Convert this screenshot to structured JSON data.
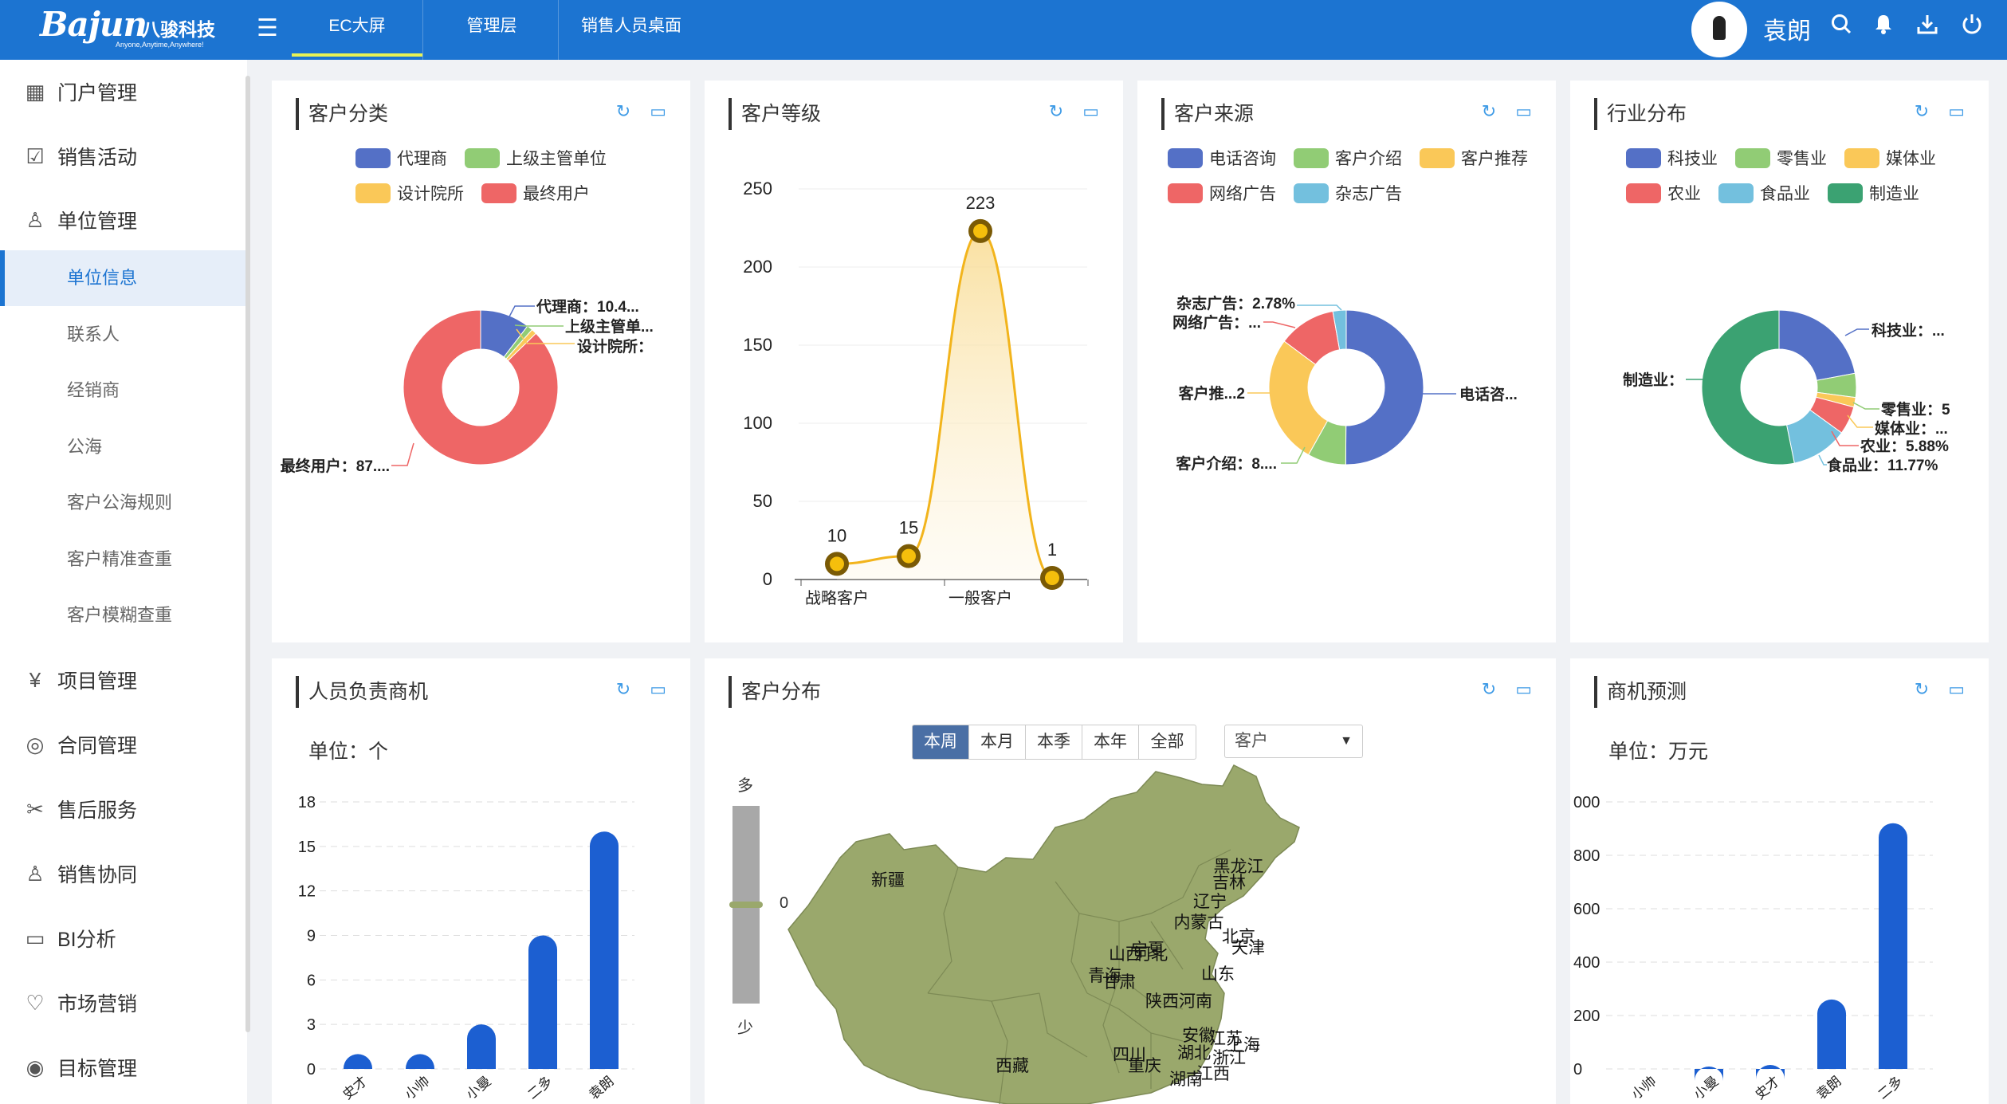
{
  "brand": {
    "name": "Bajun",
    "name_cn": "八骏科技",
    "tagline": "Anyone,Anytime,Anywhere!"
  },
  "nav": {
    "tabs": [
      "EC大屏",
      "管理层",
      "销售人员桌面"
    ]
  },
  "user": {
    "name": "袁朗"
  },
  "sidebar": {
    "items": [
      "门户管理",
      "销售活动",
      "单位管理"
    ],
    "sub_items": [
      "单位信息",
      "联系人",
      "经销商",
      "公海",
      "客户公海规则",
      "客户精准查重",
      "客户模糊查重"
    ],
    "items2": [
      "项目管理",
      "合同管理",
      "售后服务",
      "销售协同",
      "BI分析",
      "市场营销",
      "目标管理"
    ]
  },
  "colors": {
    "accent": "#1c74d1",
    "blue": "#5470c6",
    "green": "#91cc75",
    "yellow": "#fac858",
    "red": "#ee6666",
    "cyan": "#73c0de",
    "teal": "#3ba272",
    "map": "#9aa86c",
    "bar": "#1c5fd1"
  },
  "cards": {
    "customer_category": {
      "title": "客户分类"
    },
    "customer_level": {
      "title": "客户等级"
    },
    "customer_source": {
      "title": "客户来源"
    },
    "industry": {
      "title": "行业分布"
    },
    "staff_opps": {
      "title": "人员负责商机",
      "unit": "单位：个"
    },
    "customer_dist": {
      "title": "客户分布",
      "periods": [
        "本周",
        "本月",
        "本季",
        "本年",
        "全部"
      ],
      "select": "客户",
      "scale_high": "多",
      "scale_low": "少",
      "scale_value": "0"
    },
    "forecast": {
      "title": "商机预测",
      "unit": "单位：万元"
    }
  },
  "chart_data": [
    {
      "type": "pie",
      "title": "客户分类",
      "legend": [
        "代理商",
        "上级主管单位",
        "设计院所",
        "最终用户"
      ],
      "values": [
        10.4,
        1.2,
        1.1,
        87.3
      ],
      "labels": [
        "代理商：10.4...",
        "上级主管单...",
        "设计院所：",
        "最终用户：87...."
      ]
    },
    {
      "type": "line",
      "title": "客户等级",
      "categories": [
        "战略客户",
        "",
        "一般客户",
        ""
      ],
      "values": [
        10,
        15,
        223,
        1
      ],
      "ylim": [
        0,
        250
      ],
      "yticks": [
        0,
        50,
        100,
        150,
        200,
        250
      ]
    },
    {
      "type": "pie",
      "title": "客户来源",
      "legend": [
        "电话咨询",
        "客户介绍",
        "客户推荐",
        "网络广告",
        "杂志广告"
      ],
      "values": [
        50,
        8,
        27,
        12,
        2.78
      ],
      "labels": [
        "电话咨...",
        "客户介绍：8....",
        "客户推...2",
        "网络广告：...",
        "杂志广告：2.78%"
      ]
    },
    {
      "type": "pie",
      "title": "行业分布",
      "legend": [
        "科技业",
        "零售业",
        "媒体业",
        "农业",
        "食品业",
        "制造业"
      ],
      "values": [
        22,
        5,
        2,
        5.88,
        11.77,
        53
      ],
      "labels": [
        "科技业：...",
        "零售业：5",
        "媒体业：...",
        "农业：5.88%",
        "食品业：11.77%",
        "制造业："
      ]
    },
    {
      "type": "bar",
      "title": "人员负责商机",
      "categories": [
        "史才",
        "小帅",
        "小曼",
        "二多",
        "袁朗"
      ],
      "values": [
        1,
        1,
        3,
        9,
        16
      ],
      "ylim": [
        0,
        18
      ],
      "yticks": [
        0,
        3,
        6,
        9,
        12,
        15,
        18
      ]
    },
    {
      "type": "bar",
      "title": "商机预测",
      "categories": [
        "小帅",
        "小曼",
        "史才",
        "袁朗",
        "二多"
      ],
      "values": [
        0,
        5,
        15,
        260,
        920
      ],
      "ylim": [
        0,
        1000
      ],
      "yticks": [
        "0",
        "200",
        "400",
        "600",
        "800",
        "000"
      ]
    },
    {
      "type": "map",
      "title": "客户分布",
      "regions": [
        "新疆",
        "黑龙江",
        "吉林",
        "辽宁",
        "内蒙古",
        "北京",
        "天津",
        "宁夏",
        "山西",
        "河北",
        "青海",
        "甘肃",
        "山东",
        "陕西",
        "河南",
        "西藏",
        "四川",
        "重庆",
        "湖北",
        "安徽",
        "江苏",
        "上海",
        "浙江",
        "湖南",
        "江西"
      ]
    }
  ]
}
